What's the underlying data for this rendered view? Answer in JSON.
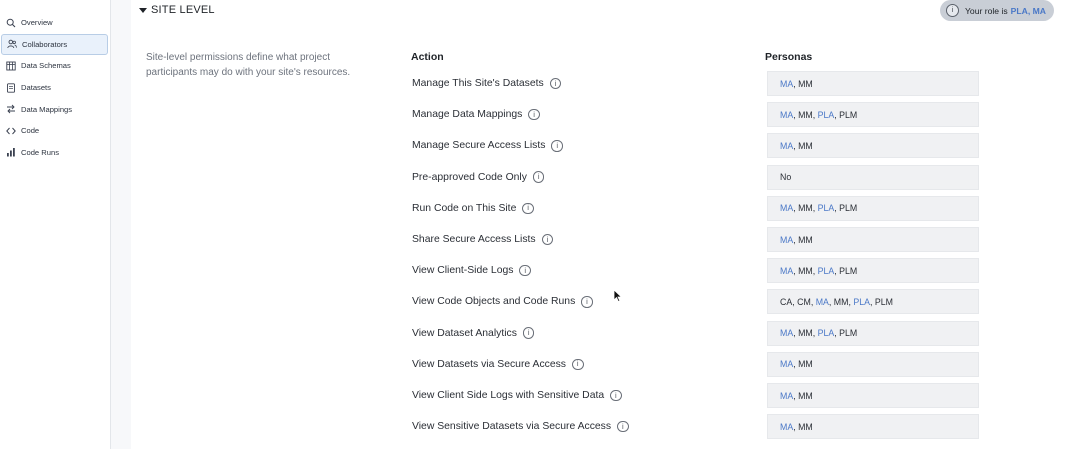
{
  "sidebar": {
    "items": [
      {
        "label": "Overview",
        "icon": "search-icon",
        "active": false
      },
      {
        "label": "Collaborators",
        "icon": "users-icon",
        "active": true
      },
      {
        "label": "Data Schemas",
        "icon": "table-icon",
        "active": false
      },
      {
        "label": "Datasets",
        "icon": "file-icon",
        "active": false
      },
      {
        "label": "Data Mappings",
        "icon": "arrows-swap-icon",
        "active": false
      },
      {
        "label": "Code",
        "icon": "code-brackets-icon",
        "active": false
      },
      {
        "label": "Code Runs",
        "icon": "bar-chart-icon",
        "active": false
      }
    ]
  },
  "section": {
    "title": "SITE LEVEL",
    "description": "Site-level permissions define what project participants may do with your site's resources."
  },
  "role": {
    "prefix": "Your role is",
    "roles": "PLA, MA",
    "info_glyph": "i"
  },
  "table": {
    "headers": {
      "action": "Action",
      "personas": "Personas"
    },
    "rows": [
      {
        "action": "Manage This Site's Datasets",
        "personas": [
          {
            "t": "MA",
            "hl": true
          },
          {
            "t": "MM",
            "hl": false
          }
        ]
      },
      {
        "action": "Manage Data Mappings",
        "personas": [
          {
            "t": "MA",
            "hl": true
          },
          {
            "t": "MM",
            "hl": false
          },
          {
            "t": "PLA",
            "hl": true
          },
          {
            "t": "PLM",
            "hl": false
          }
        ]
      },
      {
        "action": "Manage Secure Access Lists",
        "personas": [
          {
            "t": "MA",
            "hl": true
          },
          {
            "t": "MM",
            "hl": false
          }
        ]
      },
      {
        "action": "Pre-approved Code Only",
        "personas": [
          {
            "t": "No",
            "hl": false
          }
        ]
      },
      {
        "action": "Run Code on This Site",
        "personas": [
          {
            "t": "MA",
            "hl": true
          },
          {
            "t": "MM",
            "hl": false
          },
          {
            "t": "PLA",
            "hl": true
          },
          {
            "t": "PLM",
            "hl": false
          }
        ]
      },
      {
        "action": "Share Secure Access Lists",
        "personas": [
          {
            "t": "MA",
            "hl": true
          },
          {
            "t": "MM",
            "hl": false
          }
        ]
      },
      {
        "action": "View Client-Side Logs",
        "personas": [
          {
            "t": "MA",
            "hl": true
          },
          {
            "t": "MM",
            "hl": false
          },
          {
            "t": "PLA",
            "hl": true
          },
          {
            "t": "PLM",
            "hl": false
          }
        ]
      },
      {
        "action": "View Code Objects and Code Runs",
        "personas": [
          {
            "t": "CA",
            "hl": false
          },
          {
            "t": "CM",
            "hl": false
          },
          {
            "t": "MA",
            "hl": true
          },
          {
            "t": "MM",
            "hl": false
          },
          {
            "t": "PLA",
            "hl": true
          },
          {
            "t": "PLM",
            "hl": false
          }
        ]
      },
      {
        "action": "View Dataset Analytics",
        "personas": [
          {
            "t": "MA",
            "hl": true
          },
          {
            "t": "MM",
            "hl": false
          },
          {
            "t": "PLA",
            "hl": true
          },
          {
            "t": "PLM",
            "hl": false
          }
        ]
      },
      {
        "action": "View Datasets via Secure Access",
        "personas": [
          {
            "t": "MA",
            "hl": true
          },
          {
            "t": "MM",
            "hl": false
          }
        ]
      },
      {
        "action": "View Client Side Logs with Sensitive Data",
        "personas": [
          {
            "t": "MA",
            "hl": true
          },
          {
            "t": "MM",
            "hl": false
          }
        ]
      },
      {
        "action": "View Sensitive Datasets via Secure Access",
        "personas": [
          {
            "t": "MA",
            "hl": true
          },
          {
            "t": "MM",
            "hl": false
          }
        ]
      }
    ]
  },
  "colors": {
    "accent": "#4a78c7",
    "active_bg": "#e9f1fb",
    "cell_bg": "#f0f1f3"
  }
}
